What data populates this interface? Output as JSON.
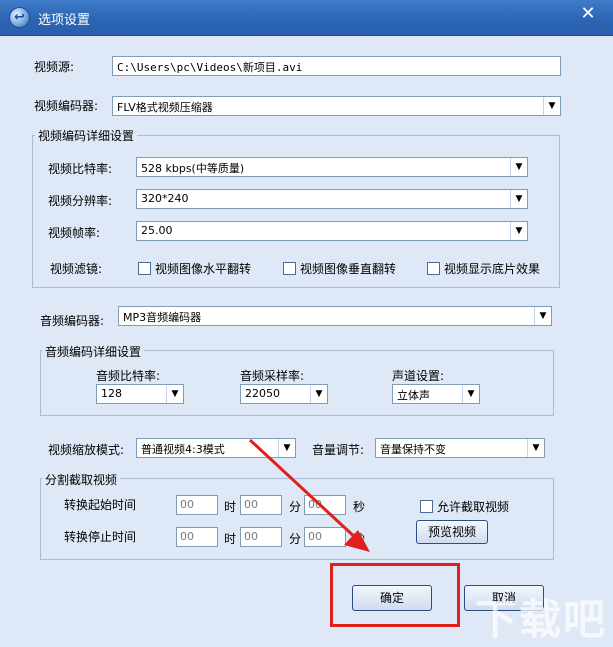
{
  "window": {
    "title": "选项设置",
    "close": "✕"
  },
  "video_source": {
    "label": "视频源:",
    "value": "C:\\Users\\pc\\Videos\\新项目.avi"
  },
  "video_encoder": {
    "label": "视频编码器:",
    "value": "FLV格式视频压缩器"
  },
  "video_detail": {
    "title": "视频编码详细设置",
    "bitrate": {
      "label": "视频比特率:",
      "value": "528 kbps(中等质量)"
    },
    "resolution": {
      "label": "视频分辨率:",
      "value": "320*240"
    },
    "framerate": {
      "label": "视频帧率:",
      "value": "25.00"
    },
    "filter_label": "视频滤镜:",
    "filters": [
      "视频图像水平翻转",
      "视频图像垂直翻转",
      "视频显示底片效果"
    ]
  },
  "audio_encoder": {
    "label": "音频编码器:",
    "value": "MP3音频编码器"
  },
  "audio_detail": {
    "title": "音频编码详细设置",
    "bitrate": {
      "label": "音频比特率:",
      "value": "128"
    },
    "samplerate": {
      "label": "音频采样率:",
      "value": "22050"
    },
    "channel": {
      "label": "声道设置:",
      "value": "立体声"
    }
  },
  "scale_mode": {
    "label": "视频缩放模式:",
    "value": "普通视频4:3模式"
  },
  "volume": {
    "label": "音量调节:",
    "value": "音量保持不变"
  },
  "split": {
    "title": "分割截取视频",
    "start_label": "转换起始时间",
    "stop_label": "转换停止时间",
    "hour": "时",
    "minute": "分",
    "second": "秒",
    "placeholder": "00",
    "allow_label": "允许截取视频",
    "preview_button": "预览视频"
  },
  "ok_button": "确定",
  "cancel_button": "取消",
  "watermark": "下载吧",
  "colors": {
    "accent_red": "#e0201c",
    "title_blue": "#2c65b5"
  }
}
